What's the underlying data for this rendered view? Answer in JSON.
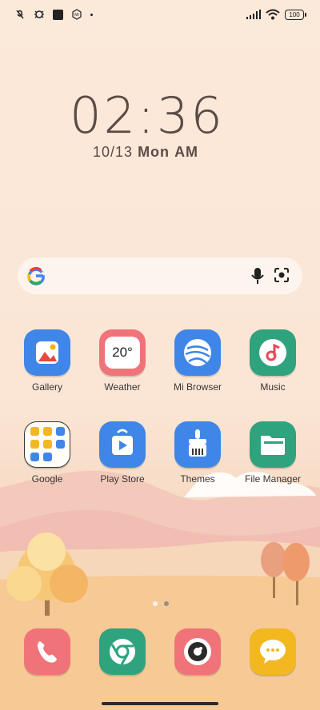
{
  "status_bar": {
    "battery": "100",
    "icons": [
      "mic-off-icon",
      "bug-icon",
      "square-icon",
      "mi-icon",
      "dot",
      "signal-icon",
      "wifi-icon",
      "battery-icon"
    ]
  },
  "clock": {
    "hours": "02",
    "separator": ":",
    "minutes": "36",
    "date": "10/13",
    "weekday": "Mon",
    "ampm": "AM"
  },
  "search": {
    "icons": [
      "google-g-icon",
      "mic-icon",
      "lens-icon"
    ]
  },
  "apps": [
    {
      "label": "Gallery",
      "color": "#3f86e8"
    },
    {
      "label": "Weather",
      "color": "#f0737a",
      "temp": "20°"
    },
    {
      "label": "Mi Browser",
      "color": "#3f86e8"
    },
    {
      "label": "Music",
      "color": "#2fa37d"
    },
    {
      "label": "Google",
      "color": "#fffdf7"
    },
    {
      "label": "Play Store",
      "color": "#3f86e8"
    },
    {
      "label": "Themes",
      "color": "#3f86e8"
    },
    {
      "label": "File Manager",
      "color": "#2fa37d"
    }
  ],
  "dock": [
    {
      "name": "phone",
      "color": "#f0737a"
    },
    {
      "name": "chrome",
      "color": "#2fa37d"
    },
    {
      "name": "camera",
      "color": "#f0737a"
    },
    {
      "name": "messages",
      "color": "#f3b81f"
    }
  ],
  "pager": {
    "pages": 2,
    "active": 0
  }
}
